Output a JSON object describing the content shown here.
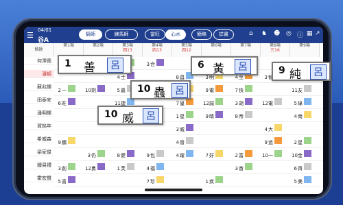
{
  "header": {
    "date": "04/01",
    "group": "谷A",
    "tabs": [
      {
        "label": "騎師",
        "on": true
      },
      {
        "label": "練馬師",
        "on": false
      },
      {
        "label": "當旺",
        "on": false
      },
      {
        "label": "心水",
        "on": true
      },
      {
        "label": "簡略",
        "on": false
      },
      {
        "label": "詳書",
        "on": false
      }
    ],
    "icons": [
      "home-icon",
      "horse-icon",
      "jockey-icon",
      "odds-icon",
      "info-icon",
      "grid-icon",
      "chart-icon"
    ]
  },
  "columns": {
    "first_label": "騎師",
    "races": [
      {
        "label": "第1場",
        "num": "",
        "sub": ""
      },
      {
        "label": "第2場",
        "num": "",
        "sub": ""
      },
      {
        "label": "第3場",
        "num": "四13",
        "sub": ""
      },
      {
        "label": "第4場",
        "num": "四13",
        "sub": ""
      },
      {
        "label": "第5場",
        "num": "四12",
        "sub": ""
      },
      {
        "label": "第6場",
        "num": "",
        "sub": ""
      },
      {
        "label": "第7場",
        "num": "",
        "sub": ""
      },
      {
        "label": "第8場",
        "num": "三16",
        "sub": ""
      },
      {
        "label": "第9場",
        "num": "",
        "sub": ""
      },
      {
        "label": "第10場",
        "num": "",
        "sub": ""
      }
    ],
    "sub_row": [
      "",
      "四16",
      "",
      "",
      "",
      "",
      "",
      "",
      "",
      ""
    ]
  },
  "jockeys": [
    {
      "name": "何澤堯",
      "hl": false
    },
    {
      "name": "潘頓",
      "hl": true
    },
    {
      "name": "蘇兆輝",
      "hl": false
    },
    {
      "name": "田泰安",
      "hl": false
    },
    {
      "name": "潘明輝",
      "hl": false
    },
    {
      "name": "賀銘年",
      "hl": false
    },
    {
      "name": "希威森",
      "hl": false
    },
    {
      "name": "梁家俊",
      "hl": false
    },
    {
      "name": "鍾易禮",
      "hl": false
    },
    {
      "name": "霍宏聲",
      "hl": false
    }
  ],
  "cells": [
    [
      [
        "",
        ""
      ],
      [
        "",
        ""
      ],
      [
        "7",
        "赤"
      ],
      [
        "3",
        "合"
      ],
      [
        "",
        ""
      ],
      [
        "2",
        "羽"
      ],
      [
        "5",
        "美"
      ],
      [
        "",
        ""
      ],
      [
        "",
        ""
      ],
      [
        "",
        ""
      ]
    ],
    [
      [
        "",
        ""
      ],
      [
        "",
        ""
      ],
      [
        "4",
        "士"
      ],
      [
        "",
        ""
      ],
      [
        "8",
        "昌"
      ],
      [
        "3",
        "明"
      ],
      [
        "4",
        "至"
      ],
      [
        "3",
        "智"
      ],
      [
        "",
        ""
      ],
      [
        "",
        ""
      ]
    ],
    [
      [
        "2",
        "一"
      ],
      [
        "10",
        "劍"
      ],
      [
        "5",
        "嘉"
      ],
      [
        "",
        ""
      ],
      [
        "3",
        "賀"
      ],
      [
        "9",
        "電"
      ],
      [
        "7",
        "快"
      ],
      [
        "",
        ""
      ],
      [
        "11",
        "友"
      ],
      [
        "",
        ""
      ]
    ],
    [
      [
        "6",
        "旺"
      ],
      [
        "",
        ""
      ],
      [
        "11",
        "捷"
      ],
      [
        "",
        ""
      ],
      [
        "7",
        "皇"
      ],
      [
        "12",
        "誠"
      ],
      [
        "3",
        "胡"
      ],
      [
        "12",
        "電"
      ],
      [
        "5",
        "綠"
      ],
      [
        "",
        ""
      ]
    ],
    [
      [
        "",
        ""
      ],
      [
        "",
        ""
      ],
      [
        "",
        ""
      ],
      [
        "",
        ""
      ],
      [
        "1",
        "星"
      ],
      [
        "9",
        "晴"
      ],
      [
        "8",
        "帝"
      ],
      [
        "",
        ""
      ],
      [
        "4",
        "南"
      ],
      [
        "",
        ""
      ]
    ],
    [
      [
        "",
        ""
      ],
      [
        "",
        ""
      ],
      [
        "",
        ""
      ],
      [
        "",
        ""
      ],
      [
        "3",
        "威"
      ],
      [
        "",
        ""
      ],
      [
        "",
        ""
      ],
      [
        "4",
        "大"
      ],
      [
        "",
        ""
      ],
      [
        "",
        ""
      ]
    ],
    [
      [
        "9",
        "鵬"
      ],
      [
        "",
        ""
      ],
      [
        "",
        ""
      ],
      [
        "",
        ""
      ],
      [
        "4",
        "晉"
      ],
      [
        "",
        ""
      ],
      [
        "",
        ""
      ],
      [
        "9",
        "追"
      ],
      [
        "2",
        "星"
      ],
      [
        "",
        ""
      ]
    ],
    [
      [
        "",
        ""
      ],
      [
        "3",
        "仍"
      ],
      [
        "8",
        "健"
      ],
      [
        "9",
        "包"
      ],
      [
        "4",
        "躍"
      ],
      [
        "7",
        "好"
      ],
      [
        "2",
        "富"
      ],
      [
        "10",
        "一"
      ],
      [
        "10",
        "金"
      ],
      [
        "",
        ""
      ]
    ],
    [
      [
        "3",
        "創"
      ],
      [
        "12",
        "勇"
      ],
      [
        "1",
        "芙"
      ],
      [
        "4",
        "福"
      ],
      [
        "",
        ""
      ],
      [
        "",
        ""
      ],
      [
        "3",
        "香"
      ],
      [
        "",
        ""
      ],
      [
        "6",
        "齊"
      ],
      [
        "",
        ""
      ]
    ],
    [
      [
        "5",
        "喜"
      ],
      [
        "",
        ""
      ],
      [
        "",
        ""
      ],
      [
        "7",
        "珍"
      ],
      [
        "",
        ""
      ],
      [
        "1",
        "疾"
      ],
      [
        "",
        ""
      ],
      [
        "",
        ""
      ],
      [
        "5",
        "美"
      ],
      [
        "",
        ""
      ]
    ]
  ],
  "callouts": [
    {
      "num": "1",
      "name": "善",
      "jockey": "呂"
    },
    {
      "num": "10",
      "name": "蟲",
      "jockey": "呂"
    },
    {
      "num": "6",
      "name": "黃",
      "jockey": "呂"
    },
    {
      "num": "9",
      "name": "純",
      "jockey": "呂"
    },
    {
      "num": "10",
      "name": "威",
      "jockey": "呂"
    }
  ],
  "tag_colors": {
    "yellow": "#f7d66a",
    "orange": "#f59a3c",
    "green": "#9bd48a",
    "purple": "#8a6ac8",
    "grey": "#c9c9c9",
    "blue": "#7fb6f0"
  }
}
